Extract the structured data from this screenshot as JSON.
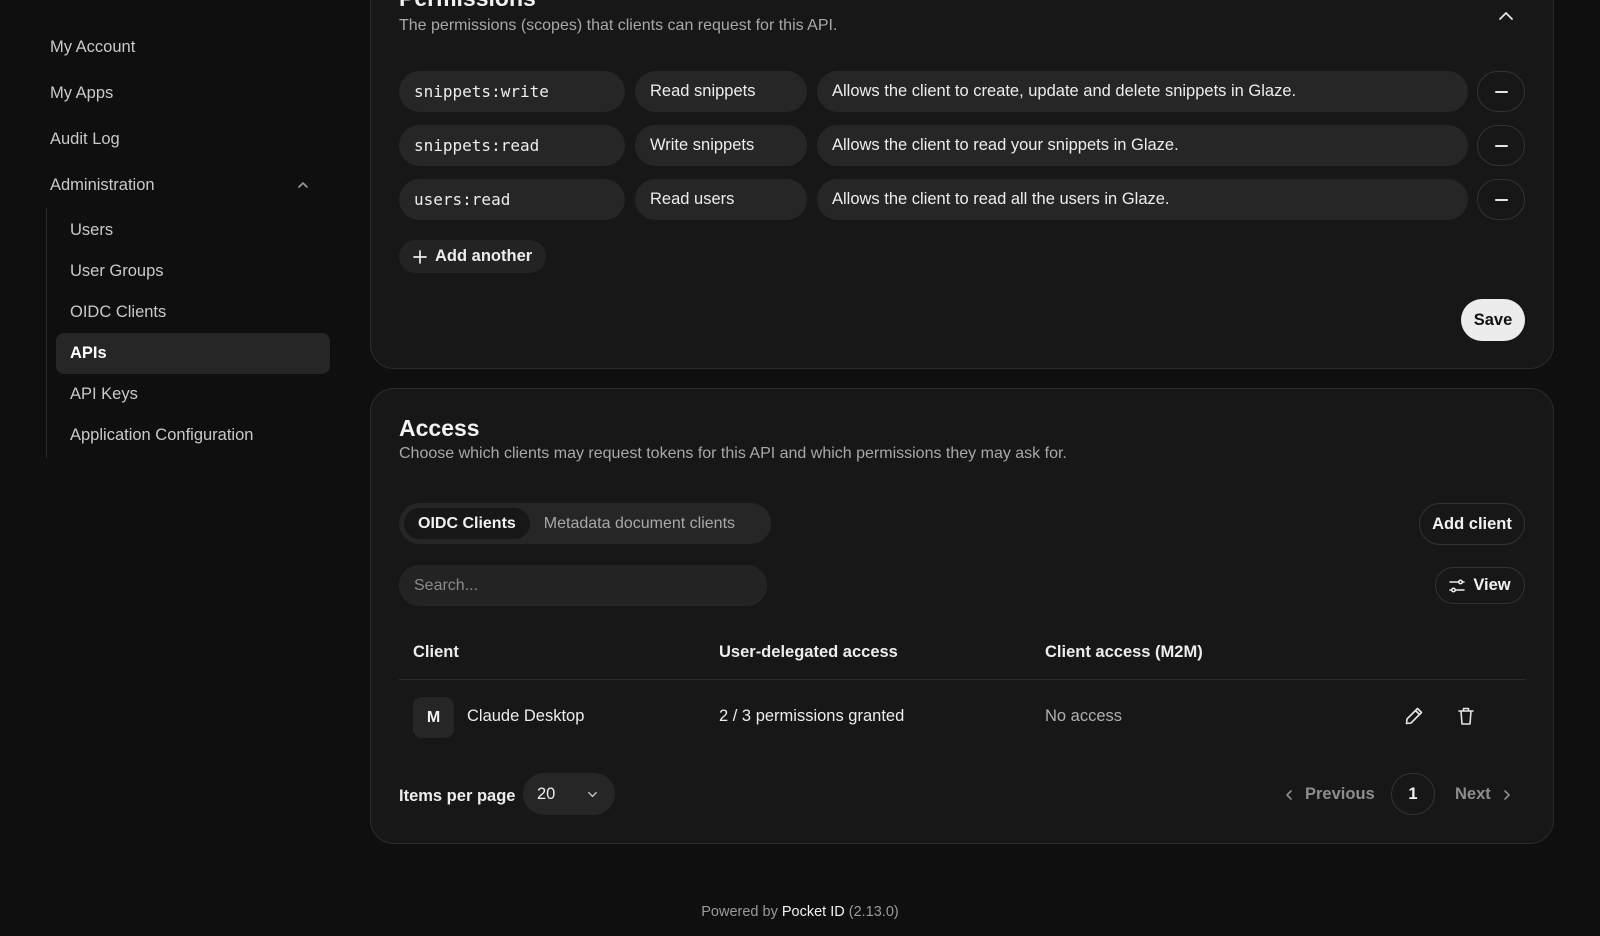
{
  "sidebar": {
    "items": [
      {
        "label": "My Account"
      },
      {
        "label": "My Apps"
      },
      {
        "label": "Audit Log"
      }
    ],
    "group": {
      "label": "Administration",
      "items": [
        {
          "label": "Users"
        },
        {
          "label": "User Groups"
        },
        {
          "label": "OIDC Clients"
        },
        {
          "label": "APIs",
          "active": true
        },
        {
          "label": "API Keys"
        },
        {
          "label": "Application Configuration"
        }
      ]
    }
  },
  "permissions": {
    "title_partial": "Permissions",
    "description": "The permissions (scopes) that clients can request for this API.",
    "rows": [
      {
        "scope": "snippets:write",
        "name": "Read snippets",
        "description": "Allows the client to create, update and delete snippets in Glaze."
      },
      {
        "scope": "snippets:read",
        "name": "Write snippets",
        "description": "Allows the client to read your snippets in Glaze."
      },
      {
        "scope": "users:read",
        "name": "Read users",
        "description": "Allows the client to read all the users in Glaze."
      }
    ],
    "add_another_label": "Add another",
    "save_label": "Save"
  },
  "access": {
    "title": "Access",
    "description": "Choose which clients may request tokens for this API and which permissions they may ask for.",
    "tabs": [
      {
        "label": "OIDC Clients",
        "active": true
      },
      {
        "label": "Metadata document clients",
        "active": false
      }
    ],
    "add_client_label": "Add client",
    "search_placeholder": "Search...",
    "view_label": "View",
    "columns": [
      "Client",
      "User-delegated access",
      "Client access (M2M)"
    ],
    "rows": [
      {
        "avatar": "M",
        "client": "Claude Desktop",
        "delegated": "2 / 3 permissions granted",
        "m2m": "No access"
      }
    ],
    "items_per_page_label": "Items per page",
    "items_per_page": "20",
    "pager": {
      "previous": "Previous",
      "page": "1",
      "next": "Next"
    }
  },
  "footer": {
    "prefix": "Powered by",
    "brand": "Pocket ID",
    "version": "(2.13.0)"
  }
}
